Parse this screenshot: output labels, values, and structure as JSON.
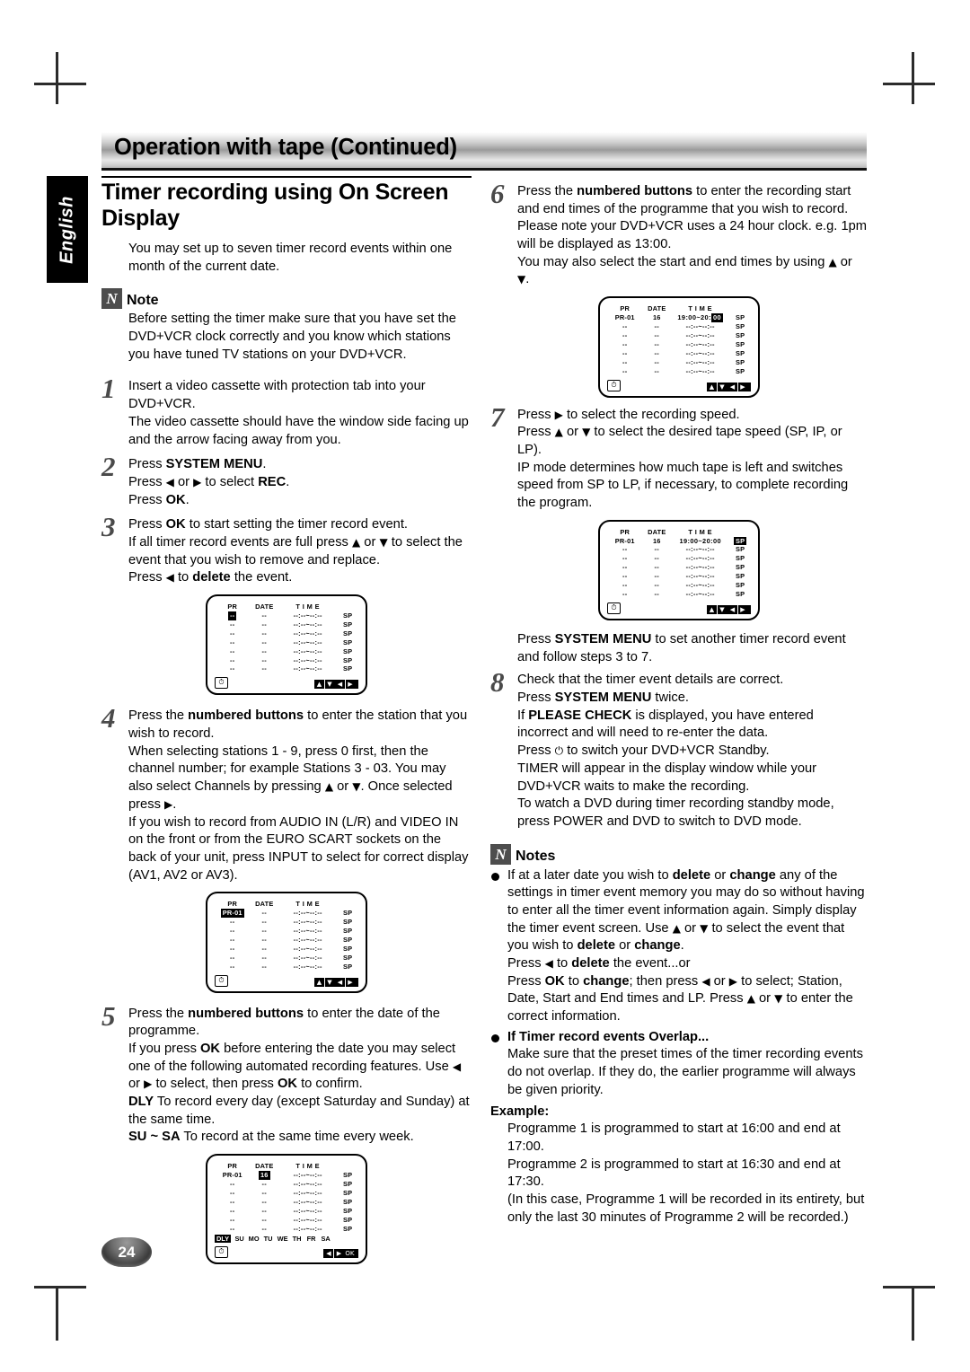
{
  "header": {
    "title": "Operation with tape (Continued)"
  },
  "language_tab": {
    "label": "English"
  },
  "page_number": "24",
  "left": {
    "section_title": "Timer recording using On Screen Display",
    "intro": "You may set up to seven timer record events within one month of the current date.",
    "note": {
      "glyph": "N",
      "label": "Note",
      "text": "Before setting the timer make sure that you have set the DVD+VCR clock correctly and you know which stations you have tuned TV stations on your DVD+VCR."
    },
    "steps": [
      {
        "num": "1",
        "lines": [
          "Insert a video cassette with protection tab into your DVD+VCR.",
          "The video cassette should have the window side facing up and the arrow facing away from you."
        ]
      },
      {
        "num": "2",
        "lines": [
          "Press SYSTEM MENU.",
          "Press ◀ or ▶ to select REC.",
          "Press OK."
        ]
      },
      {
        "num": "3",
        "lines": [
          "Press OK to start setting the timer record event.",
          "If all timer record events are full press ▲ or ▼ to select the event that you wish to remove and replace.",
          "Press ◀ to delete the event."
        ]
      },
      {
        "num": "4",
        "lines": [
          "Press the numbered buttons to enter the station that you wish to record.",
          "When selecting stations 1 - 9, press 0 first, then the channel number; for example Stations 3 - 03. You may also select Channels by pressing ▲ or ▼. Once selected press ▶.",
          "If you wish to record from AUDIO IN (L/R) and VIDEO IN on the front or from the EURO SCART sockets on the back of your unit, press INPUT to select for correct display (AV1, AV2 or AV3)."
        ]
      },
      {
        "num": "5",
        "lines": [
          "Press the numbered buttons to enter the date of the programme.",
          "If you press OK before entering the date you may select one of the following automated recording features. Use ◀ or ▶ to select, then press OK to confirm.",
          "DLY To record every day (except Saturday and Sunday) at the same time.",
          "SU ~ SA To record at the same time every week."
        ]
      }
    ]
  },
  "right": {
    "steps": [
      {
        "num": "6",
        "lines": [
          "Press the numbered buttons to enter the recording start and end times of the programme that you wish to record.",
          "Please note your DVD+VCR uses a 24 hour clock. e.g. 1pm will be displayed as 13:00.",
          "You may also select the start and end times by using ▲ or ▼."
        ]
      },
      {
        "num": "7",
        "lines": [
          "Press ▶ to select the recording speed.",
          "Press ▲ or ▼ to select the desired tape speed (SP, IP, or LP).",
          "IP mode determines how much tape is left and switches speed from SP to LP, if necessary, to complete recording the program."
        ]
      }
    ],
    "after_step7": "Press SYSTEM MENU to set another timer record event and follow steps 3 to 7.",
    "step8": {
      "num": "8",
      "lines": [
        "Check that the timer event details are correct.",
        "Press SYSTEM MENU twice.",
        "If PLEASE CHECK is displayed, you have entered incorrect and will need to re-enter the data.",
        "Press ⏻ to switch your DVD+VCR Standby.",
        "TIMER will appear in the display window while your DVD+VCR waits to make the recording.",
        "To watch a DVD during timer recording standby mode, press POWER and DVD to switch to DVD mode."
      ]
    },
    "notes": {
      "glyph": "N",
      "label": "Notes",
      "items": [
        {
          "heading": "",
          "lines": [
            "If at a later date you wish to delete or change any of the settings in timer event memory you may do so without having to enter all the timer event information again. Simply display the timer event screen. Use ▲ or ▼ to select the event that you wish to delete or change.",
            "Press ◀ to delete the event...or",
            "Press OK to change; then press ◀ or ▶ to select; Station, Date, Start and End times and LP. Press ▲ or ▼ to enter the correct information."
          ]
        },
        {
          "heading": "If Timer record events Overlap...",
          "lines": [
            "Make sure that the preset times of the timer recording events do not overlap. If they do, the earlier programme will always be given priority."
          ]
        }
      ],
      "example_label": "Example:",
      "example_lines": [
        "Programme 1 is programmed to start at 16:00 and end at 17:00.",
        "Programme 2 is programmed to start at 16:30 and end at 17:30.",
        "(In this case, Programme 1 will be recorded in its entirety, but only the last 30 minutes of Programme 2 will be recorded.)"
      ]
    }
  },
  "osd": {
    "columns": {
      "pr": "PR",
      "date": "DATE",
      "time": "T I M E"
    },
    "blank_pr": "--",
    "blank_date": "--",
    "blank_time": "--:--~--:--",
    "speed": "SP",
    "clock_icon": "⏱",
    "nav_updown": [
      "▲",
      "▼",
      "◀",
      "▶"
    ],
    "nav_lr_ok": [
      "◀",
      "▶",
      "OK"
    ],
    "days": [
      "SU",
      "MO",
      "TU",
      "WE",
      "TH",
      "FR",
      "SA"
    ],
    "dly_label": "DLY",
    "screens": [
      {
        "id": "osd-empty",
        "highlight": "pr-blank",
        "pr": "--",
        "date": "--",
        "time": "--:--~--:--",
        "nav": "updown"
      },
      {
        "id": "osd-station",
        "highlight": "pr",
        "pr": "PR-01",
        "date": "--",
        "time": "--:--~--:--",
        "nav": "updown"
      },
      {
        "id": "osd-date",
        "highlight": "date",
        "pr": "PR-01",
        "date": "16",
        "time": "--:--~--:--",
        "nav": "lrok",
        "days": true
      },
      {
        "id": "osd-time",
        "highlight": "time-end",
        "pr": "PR-01",
        "date": "16",
        "time_a": "19:00~20:",
        "time_b": "00",
        "nav": "updown"
      },
      {
        "id": "osd-speed",
        "highlight": "speed",
        "pr": "PR-01",
        "date": "16",
        "time": "19:00~20:00",
        "nav": "updown"
      }
    ]
  }
}
